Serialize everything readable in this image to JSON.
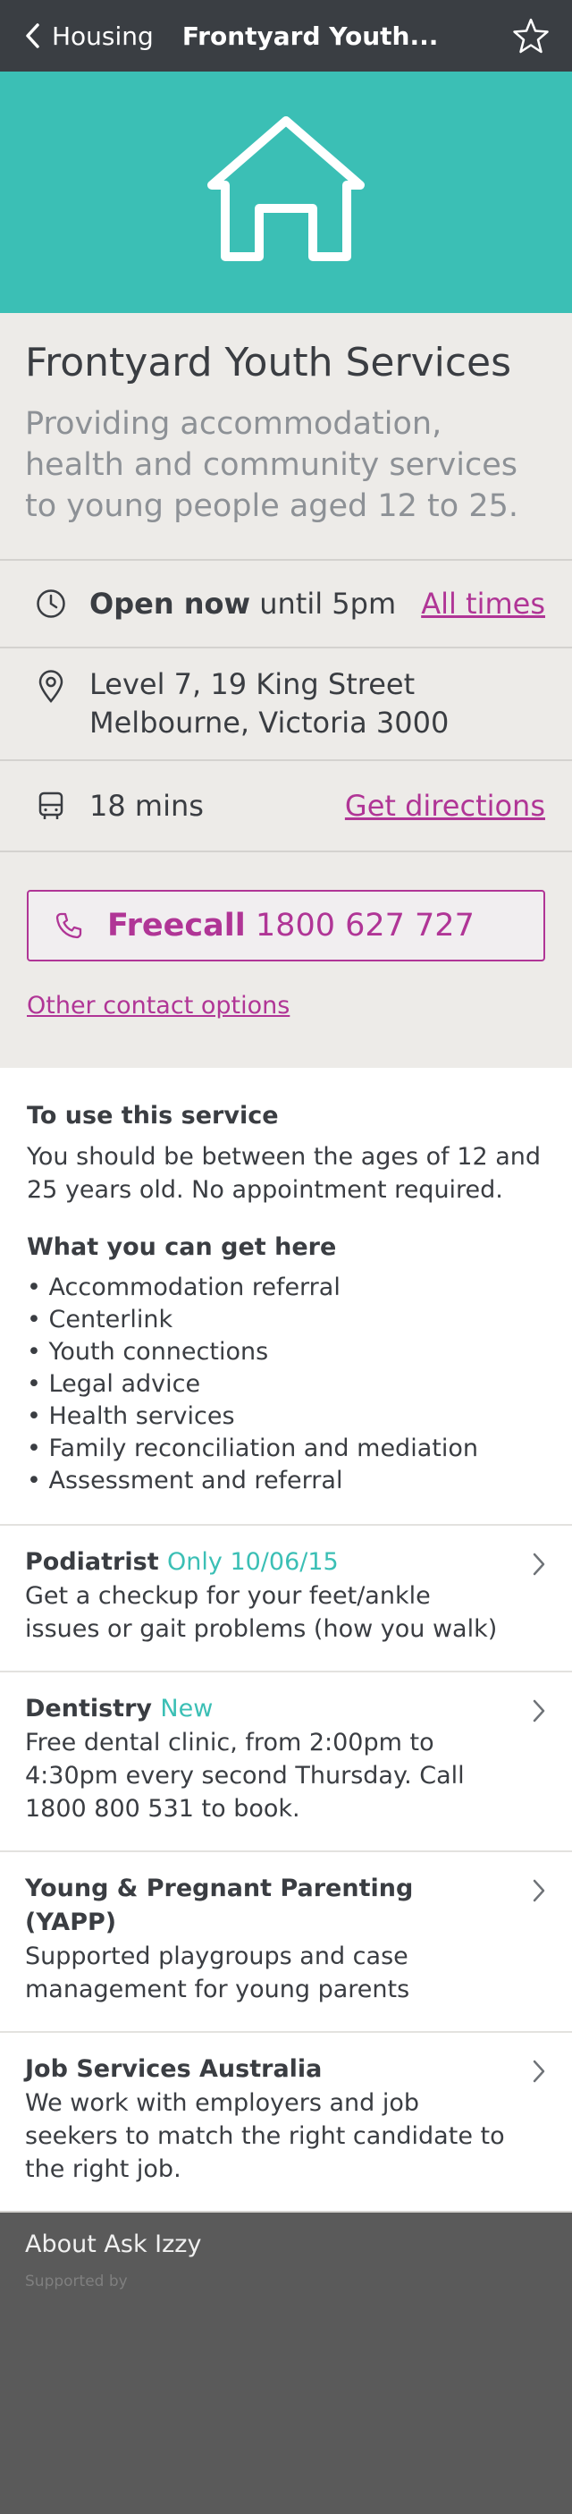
{
  "header": {
    "back_label": "Housing",
    "title": "Frontyard Youth..."
  },
  "service": {
    "name": "Frontyard Youth Services",
    "description": "Providing accommodation, health and community services to young people aged 12 to 25."
  },
  "hours": {
    "status": "Open now",
    "until": "until 5pm",
    "link": "All times"
  },
  "address": {
    "line1": "Level 7, 19 King Street",
    "line2": "Melbourne, Victoria 3000"
  },
  "transport": {
    "time": "18 mins",
    "link": "Get directions"
  },
  "contact": {
    "call_label": "Freecall",
    "call_number": "1800 627 727",
    "other_link": "Other contact options"
  },
  "eligibility": {
    "heading": "To use this service",
    "text": "You should be between the ages of 12 and 25 years old. No appointment required."
  },
  "offerings": {
    "heading": "What you can get here",
    "items": [
      "• Accommodation referral",
      "• Centerlink",
      "• Youth connections",
      "• Legal advice",
      "• Health services",
      "• Family reconciliation and mediation",
      "• Assessment and referral"
    ]
  },
  "services": [
    {
      "name": "Podiatrist",
      "tag": "Only 10/06/15",
      "desc": "Get a checkup for your feet/ankle issues or gait problems (how you walk)"
    },
    {
      "name": "Dentistry",
      "tag": "New",
      "desc": "Free dental clinic, from 2:00pm to 4:30pm every second Thursday. Call 1800 800 531 to book."
    },
    {
      "name": "Young & Pregnant Parenting (YAPP)",
      "tag": "",
      "desc": "Supported playgroups and case management for young parents"
    },
    {
      "name": "Job Services Australia",
      "tag": "",
      "desc": "We work with employers and job seekers to match the right candidate to the right job."
    }
  ],
  "footer": {
    "about": "About Ask Izzy",
    "supported": "Supported by"
  },
  "icons": {
    "back": "chevron-left-icon",
    "favourite": "star-icon",
    "banner": "house-icon",
    "hours": "clock-icon",
    "address": "location-pin-icon",
    "transport": "bus-icon",
    "call": "phone-icon",
    "service_arrow": "chevron-right-icon"
  },
  "colors": {
    "header_bg": "#3a3e43",
    "banner_bg": "#3bbfb5",
    "accent": "#b03596",
    "tag": "#3bbfb5",
    "panel_bg": "#edebe8",
    "footer_bg": "#5a5a5a"
  }
}
